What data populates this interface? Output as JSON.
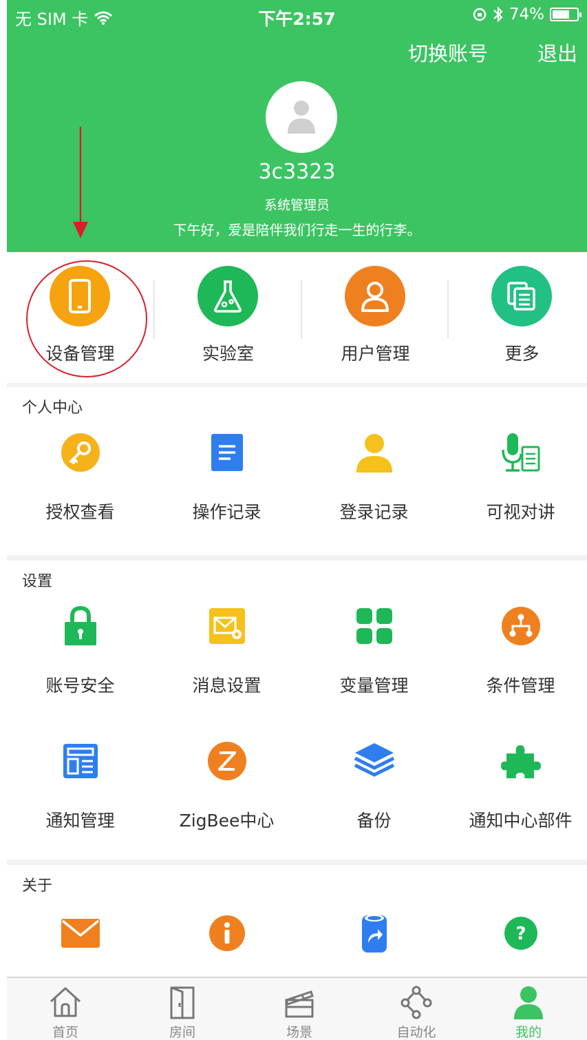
{
  "status_bar": {
    "carrier": "无 SIM 卡",
    "time": "下午2:57",
    "battery": "74%",
    "battery_level": 0.74
  },
  "header": {
    "switch_account": "切换账号",
    "logout": "退出",
    "username": "3c3323",
    "role": "系统管理员",
    "greeting": "下午好，爱是陪伴我们行走一生的行李。"
  },
  "quick_actions": [
    {
      "label": "设备管理",
      "icon": "phone-icon",
      "color": "#f5a30f"
    },
    {
      "label": "实验室",
      "icon": "flask-icon",
      "color": "#1fb858"
    },
    {
      "label": "用户管理",
      "icon": "user-icon",
      "color": "#ef8020"
    },
    {
      "label": "更多",
      "icon": "copy-icon",
      "color": "#22c085"
    }
  ],
  "personal_center": {
    "title": "个人中心",
    "items": [
      {
        "label": "授权查看",
        "icon": "key-icon"
      },
      {
        "label": "操作记录",
        "icon": "document-icon"
      },
      {
        "label": "登录记录",
        "icon": "person-icon"
      },
      {
        "label": "可视对讲",
        "icon": "microphone-icon"
      }
    ]
  },
  "settings": {
    "title": "设置",
    "items": [
      {
        "label": "账号安全",
        "icon": "lock-icon"
      },
      {
        "label": "消息设置",
        "icon": "mail-settings-icon"
      },
      {
        "label": "变量管理",
        "icon": "grid-icon"
      },
      {
        "label": "条件管理",
        "icon": "hierarchy-icon"
      },
      {
        "label": "通知管理",
        "icon": "layout-icon"
      },
      {
        "label": "ZigBee中心",
        "icon": "zigbee-icon"
      },
      {
        "label": "备份",
        "icon": "layers-icon"
      },
      {
        "label": "通知中心部件",
        "icon": "puzzle-icon"
      }
    ]
  },
  "about": {
    "title": "关于",
    "items": [
      {
        "icon": "envelope-icon"
      },
      {
        "icon": "info-icon"
      },
      {
        "icon": "share-icon"
      },
      {
        "icon": "help-icon"
      }
    ]
  },
  "tabbar": [
    {
      "label": "首页",
      "icon": "home-icon"
    },
    {
      "label": "房间",
      "icon": "door-icon"
    },
    {
      "label": "场景",
      "icon": "clapper-icon"
    },
    {
      "label": "自动化",
      "icon": "nodes-icon"
    },
    {
      "label": "我的",
      "icon": "profile-icon",
      "active": true
    }
  ],
  "colors": {
    "header_green": "#3cc462",
    "annotation_red": "#d8202a",
    "active_tab": "#3cc462"
  }
}
